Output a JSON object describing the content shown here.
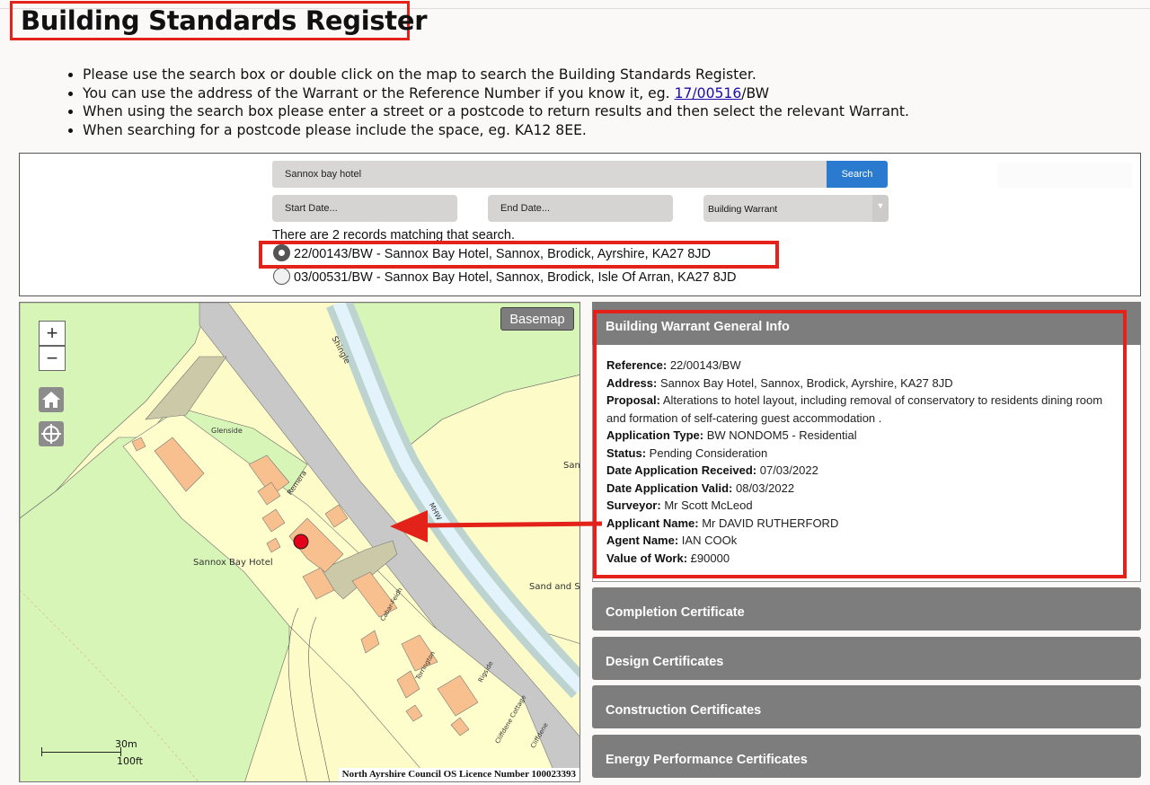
{
  "page": {
    "title": "Building Standards Register",
    "instructions": [
      {
        "before": "Please use the search box or double click on the map to search the Building Standards Register.",
        "link": "",
        "after": ""
      },
      {
        "before": "You can use the address of the Warrant or the Reference Number if you know it, eg. ",
        "link": "17/00516",
        "after": "/BW"
      },
      {
        "before": "When using the search box please enter a street or a postcode to return results and then select the relevant Warrant.",
        "link": "",
        "after": ""
      },
      {
        "before": "When searching for a postcode please include the space, eg. KA12 8EE.",
        "link": "",
        "after": ""
      }
    ]
  },
  "search": {
    "query": "Sannox bay hotel",
    "button_label": "Search",
    "start_date_placeholder": "Start Date...",
    "end_date_placeholder": "End Date...",
    "type_selected": "Building Warrant",
    "results_count_text": "There are 2 records matching that search.",
    "results": [
      {
        "label": "22/00143/BW - Sannox Bay Hotel, Sannox, Brodick, Ayrshire, KA27 8JD",
        "selected": true
      },
      {
        "label": "03/00531/BW - Sannox Bay Hotel, Sannox, Brodick, Isle Of Arran, KA27 8JD",
        "selected": false
      }
    ]
  },
  "map": {
    "zoom_in": "+",
    "zoom_out": "−",
    "tools": [
      "home-icon",
      "locate-icon"
    ],
    "basemap_label": "Basemap",
    "scale_metric": "30m",
    "scale_imperial": "100ft",
    "licence_text": "North Ayrshire Council OS Licence Number 100023393",
    "labels": {
      "glenside": "Glenside",
      "remera": "Remera",
      "hotel": "Sannox Bay Hotel",
      "shingle": "Shingle",
      "san": "San",
      "mhw": "MHW",
      "sand": "Sand and S",
      "cabar": "Cabar-Feidh",
      "torrington": "Torrington",
      "rigside": "Rigside",
      "cliffdene_cottage": "Cliffdene Cottage",
      "cliffdene": "Cliffdene"
    },
    "colors": {
      "land": "#fdfcc8",
      "grass": "#d8f5b8",
      "building": "#f7c08e",
      "road": "#c8c8c8",
      "marker": "#e3001b"
    }
  },
  "info": {
    "header": "Building Warrant General Info",
    "fields": [
      {
        "label": "Reference:",
        "value": " 22/00143/BW"
      },
      {
        "label": "Address:",
        "value": " Sannox Bay Hotel, Sannox, Brodick, Ayrshire, KA27 8JD"
      },
      {
        "label": "Proposal:",
        "value": " Alterations to hotel layout, including removal of conservatory to residents dining room and formation of self-catering guest accommodation ."
      },
      {
        "label": "Application Type:",
        "value": " BW NONDOM5 - Residential"
      },
      {
        "label": "Status:",
        "value": " Pending Consideration"
      },
      {
        "label": "Date Application Received:",
        "value": " 07/03/2022"
      },
      {
        "label": "Date Application Valid:",
        "value": " 08/03/2022"
      },
      {
        "label": "Surveyor:",
        "value": " Mr Scott McLeod"
      },
      {
        "label": "Applicant Name:",
        "value": " Mr DAVID RUTHERFORD"
      },
      {
        "label": "Agent Name:",
        "value": " IAN COOk"
      },
      {
        "label": "Value of Work:",
        "value": " £90000"
      }
    ]
  },
  "accordions": [
    "Completion Certificate",
    "Design Certificates",
    "Construction Certificates",
    "Energy Performance Certificates"
  ],
  "annotation_color": "#e3231a"
}
